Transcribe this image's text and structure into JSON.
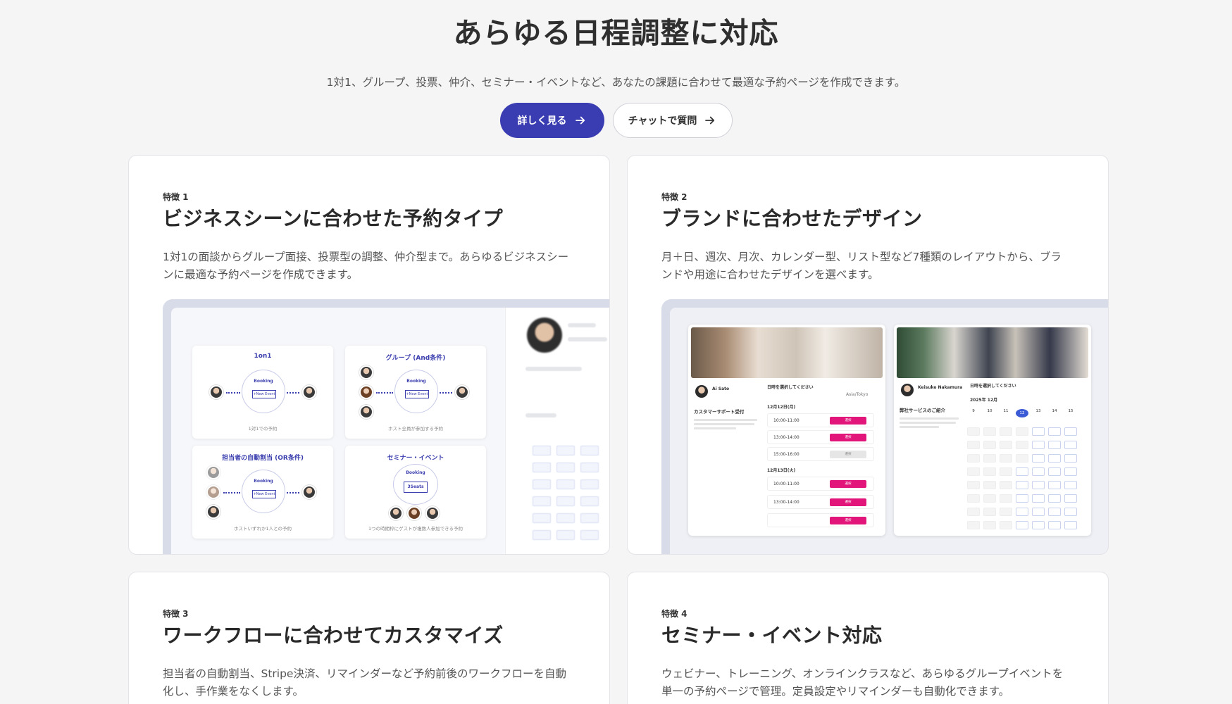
{
  "hero": {
    "title": "あらゆる日程調整に対応",
    "subtitle": "1対1、グループ、投票、仲介、セミナー・イベントなど、あなたの課題に合わせて最適な予約ページを作成できます。",
    "primary_button": "詳しく見る",
    "secondary_button": "チャットで質問",
    "accent_color": "#3a3cb1"
  },
  "features": [
    {
      "label": "特徴 1",
      "title": "ビジネスシーンに合わせた予約タイプ",
      "desc": "1対1の面談からグループ面接、投票型の調整、仲介型まで。あらゆるビジネスシーンに最適な予約ページを作成できます。",
      "tiles": [
        {
          "title": "1on1",
          "caption": "1対1での予約"
        },
        {
          "title": "グループ (And条件)",
          "caption": "ホスト全員が参加する予約"
        },
        {
          "title": "担当者の自動割当 (OR条件)",
          "caption": "ホストいずれか1人との予約"
        },
        {
          "title": "セミナー・イベント",
          "caption": "1つの時間枠にゲストが複数人参加できる予約"
        }
      ],
      "booking_label": "Booking",
      "new_event_label": "+New Event",
      "seats_label": "3Seats"
    },
    {
      "label": "特徴 2",
      "title": "ブランドに合わせたデザイン",
      "desc": "月＋日、週次、月次、カレンダー型、リスト型など7種類のレイアウトから、ブランドや用途に合わせたデザインを選べます。",
      "mock_a": {
        "name": "Ai Sato",
        "event": "カスタマーサポート受付",
        "prompt": "日時を選択してください",
        "tz": "Asia/Tokyo",
        "date1": "12月12日(月)",
        "date2": "12月13日(火)",
        "slots": [
          "10:00-11:00",
          "13:00-14:00",
          "15:00-16:00",
          "10:00-11:00",
          "13:00-14:00"
        ],
        "select": "選択"
      },
      "mock_b": {
        "name": "Keisuke Nakamura",
        "event": "弊社サービスのご紹介",
        "prompt": "日時を選択してください",
        "month": "2025年 12月",
        "days": [
          "9",
          "10",
          "11",
          "12",
          "13",
          "14",
          "15"
        ]
      }
    },
    {
      "label": "特徴 3",
      "title": "ワークフローに合わせてカスタマイズ",
      "desc": "担当者の自動割当、Stripe決済、リマインダーなど予約前後のワークフローを自動化し、手作業をなくします。"
    },
    {
      "label": "特徴 4",
      "title": "セミナー・イベント対応",
      "desc": "ウェビナー、トレーニング、オンラインクラスなど、あらゆるグループイベントを単一の予約ページで管理。定員設定やリマインダーも自動化できます。"
    }
  ]
}
